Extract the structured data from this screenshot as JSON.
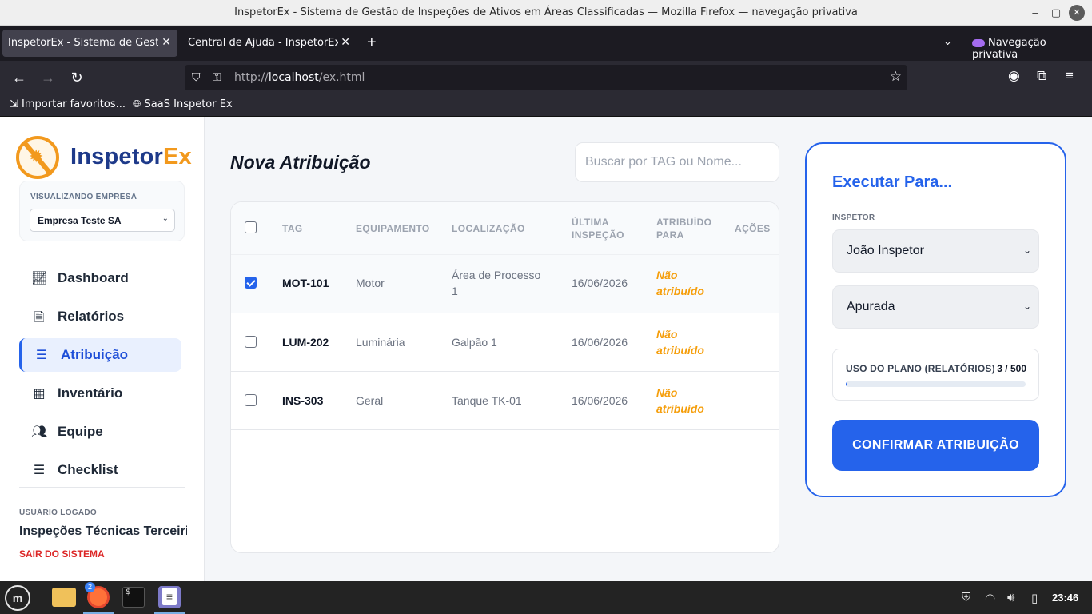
{
  "window": {
    "title": "InspetorEx - Sistema de Gestão de Inspeções de Ativos em Áreas Classificadas — Mozilla Firefox — navegação privativa",
    "minimize": "–",
    "maximize": "▢",
    "close": "✕"
  },
  "browser": {
    "tabs": [
      {
        "label": "InspetorEx - Sistema de Gestão de Inspeções",
        "close": "✕"
      },
      {
        "label": "Central de Ajuda - InspetorEx",
        "close": "✕"
      }
    ],
    "new_tab": "+",
    "tab_list": "⌄",
    "private_label": "Navegação privativa",
    "url_prefix": "http://",
    "url_host": "localhost",
    "url_path": "/ex.html",
    "bookmarks": [
      {
        "label": "Importar favoritos...",
        "icon": "import-icon"
      },
      {
        "label": "SaaS Inspetor Ex",
        "icon": "globe-icon"
      }
    ]
  },
  "app": {
    "logo_part1": "Inspetor",
    "logo_part2": "Ex",
    "company_label": "VISUALIZANDO EMPRESA",
    "company_value": "Empresa Teste SA",
    "menu": [
      {
        "label": "Dashboard",
        "icon": "chart-line-icon"
      },
      {
        "label": "Relatórios",
        "icon": "document-icon"
      },
      {
        "label": "Atribuição",
        "icon": "list-check-icon",
        "active": true
      },
      {
        "label": "Inventário",
        "icon": "boxes-icon"
      },
      {
        "label": "Equipe",
        "icon": "users-icon"
      },
      {
        "label": "Checklist",
        "icon": "list-check-icon"
      }
    ],
    "user_label": "USUÁRIO LOGADO",
    "user_name": "Inspeções Técnicas Terceirizadas",
    "logout": "SAIR DO SISTEMA"
  },
  "main": {
    "title": "Nova Atribuição",
    "search_placeholder": "Buscar por TAG ou Nome...",
    "columns": {
      "tag": "TAG",
      "equipment": "EQUIPAMENTO",
      "location": "LOCALIZAÇÃO",
      "last_inspection_1": "ÚLTIMA",
      "last_inspection_2": "INSPEÇÃO",
      "assigned_1": "ATRIBUÍDO",
      "assigned_2": "PARA",
      "actions": "AÇÕES"
    },
    "rows": [
      {
        "tag": "MOT-101",
        "equipment": "Motor",
        "location_1": "Área de Processo",
        "location_2": "1",
        "last": "16/06/2026",
        "status_1": "Não",
        "status_2": "atribuído",
        "checked": true
      },
      {
        "tag": "LUM-202",
        "equipment": "Luminária",
        "location_1": "Galpão 1",
        "location_2": "",
        "last": "16/06/2026",
        "status_1": "Não",
        "status_2": "atribuído",
        "checked": false
      },
      {
        "tag": "INS-303",
        "equipment": "Geral",
        "location_1": "Tanque TK-01",
        "location_2": "",
        "last": "16/06/2026",
        "status_1": "Não",
        "status_2": "atribuído",
        "checked": false
      }
    ]
  },
  "exec": {
    "title": "Executar Para...",
    "inspector_label": "INSPETOR",
    "inspector_value": "João Inspetor",
    "mode_value": "Apurada",
    "usage_label": "USO DO PLANO (RELATÓRIOS)",
    "usage_count": "3 / 500",
    "usage_fraction": 0.006,
    "confirm": "CONFIRMAR ATRIBUIÇÃO"
  },
  "taskbar": {
    "badge": "2",
    "term_text": "$_",
    "clock": "23:46"
  },
  "colors": {
    "accent": "#2563eb",
    "brand_orange": "#f2991d",
    "brand_navy": "#1e3a8a",
    "status_warning": "#f59e0b",
    "danger": "#dc2626"
  }
}
